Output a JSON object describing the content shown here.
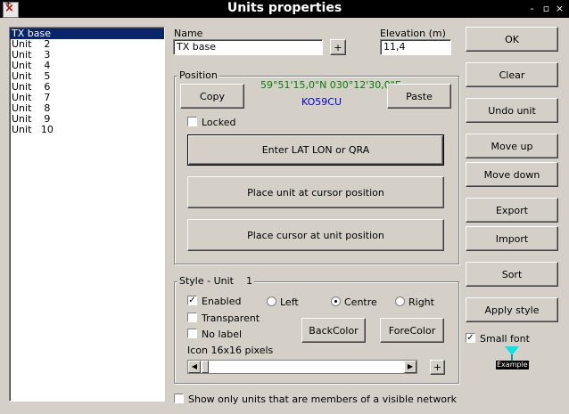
{
  "window": {
    "title": "Units properties",
    "controls": [
      "-",
      "▫",
      "×"
    ]
  },
  "unit_list": [
    "TX base",
    "Unit    2",
    "Unit    3",
    "Unit    4",
    "Unit    5",
    "Unit    6",
    "Unit    7",
    "Unit    8",
    "Unit    9",
    "Unit   10"
  ],
  "name": {
    "label": "Name",
    "value": "TX base",
    "plus": "+"
  },
  "elevation": {
    "label": "Elevation (m)",
    "value": "11,4"
  },
  "position": {
    "legend": "Position",
    "copy": "Copy",
    "paste": "Paste",
    "latlon": "59°51'15,0\"N 030°12'30,0\"E",
    "qra": "KO59CU",
    "locked": "Locked",
    "enter": "Enter LAT LON or QRA",
    "place_unit": "Place unit at cursor position",
    "place_cursor": "Place cursor at unit position"
  },
  "style": {
    "legend": "Style - Unit    1",
    "enabled": "Enabled",
    "transparent": "Transparent",
    "no_label": "No label",
    "left": "Left",
    "centre": "Centre",
    "right": "Right",
    "backcolor": "BackColor",
    "forecolor": "ForeColor",
    "icon_label": "Icon 16x16 pixels",
    "plus": "+"
  },
  "buttons": {
    "ok": "OK",
    "clear": "Clear",
    "undo": "Undo unit",
    "move_up": "Move up",
    "move_down": "Move down",
    "export": "Export",
    "import": "Import",
    "sort": "Sort",
    "apply_style": "Apply style"
  },
  "small_font": "Small font",
  "example": "Example",
  "show_only": "Show only units that are members of a visible network",
  "colors": {
    "latlon": "#008000",
    "qra": "#0000cc",
    "selection": "#0a246a",
    "example_icon": "#00e5e5"
  }
}
